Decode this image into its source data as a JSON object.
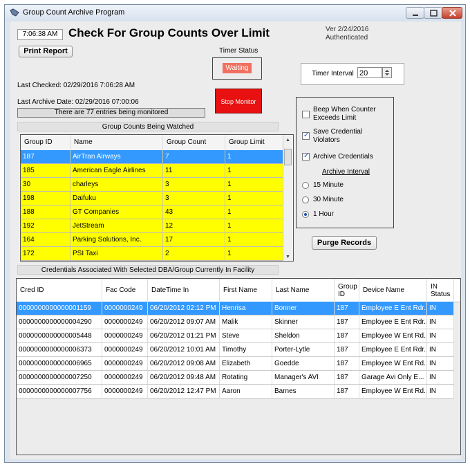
{
  "window": {
    "title": "Group Count Archive Program"
  },
  "header": {
    "time": "7:06:38 AM",
    "title": "Check For Group Counts Over Limit",
    "version": "Ver 2/24/2016",
    "auth": "Authenticated"
  },
  "controls": {
    "print_label": "Print Report",
    "timer_status_label": "Timer Status",
    "timer_status_value": "Waiting",
    "timer_interval_label": "Timer Interval",
    "timer_interval_value": "20",
    "stop_label": "Stop Monitor",
    "purge_label": "Purge Records"
  },
  "status": {
    "last_checked": "Last Checked: 02/29/2016 7:06:28 AM",
    "last_archive": "Last Archive Date: 02/29/2016 07:00:06",
    "entries": "There are 77 entries being monitored"
  },
  "options": {
    "beep": "Beep When Counter Exceeds Limit",
    "save_violators": "Save Credential Violators",
    "archive_credentials": "Archive Credentials",
    "archive_interval_label": "Archive Interval",
    "r15": "15 Minute",
    "r30": "30 Minute",
    "r60": "1 Hour",
    "beep_checked": false,
    "save_checked": true,
    "archive_checked": true,
    "interval_selected": "1 Hour"
  },
  "group_counts": {
    "title": "Group Counts Being Watched",
    "columns": [
      "Group ID",
      "Name",
      "Group Count",
      "Group Limit"
    ],
    "rows": [
      [
        "187",
        "AirTran Airways",
        "7",
        "1"
      ],
      [
        "185",
        "American Eagle Airlines",
        "11",
        "1"
      ],
      [
        "30",
        "charleys",
        "3",
        "1"
      ],
      [
        "198",
        "Daifuku",
        "3",
        "1"
      ],
      [
        "188",
        "GT Companies",
        "43",
        "1"
      ],
      [
        "192",
        "JetStream",
        "12",
        "1"
      ],
      [
        "164",
        "Parking Solutions, Inc.",
        "17",
        "1"
      ],
      [
        "172",
        "PSI Taxi",
        "2",
        "1"
      ]
    ]
  },
  "credentials": {
    "title": "Credentials Associated With Selected DBA/Group Currently In Facility",
    "columns": [
      "Cred ID",
      "Fac Code",
      "DateTime In",
      "First Name",
      "Last Name",
      "Group ID",
      "Device Name",
      "IN Status"
    ],
    "rows": [
      [
        "0000000000000001159",
        "0000000249",
        "06/20/2012 02:12 PM",
        "Henrisa",
        "Bonner",
        "187",
        "Employee E Ent Rdr...",
        "IN"
      ],
      [
        "0000000000000004290",
        "0000000249",
        "06/20/2012 09:07 AM",
        "Malik",
        "Skinner",
        "187",
        "Employee E Ent Rdr...",
        "IN"
      ],
      [
        "0000000000000005448",
        "0000000249",
        "06/20/2012 01:21 PM",
        "Steve",
        "Sheldon",
        "187",
        "Employee W Ent Rd...",
        "IN"
      ],
      [
        "0000000000000006373",
        "0000000249",
        "06/20/2012 10:01 AM",
        "Timothy",
        "Porter-Lytle",
        "187",
        "Employee E Ent Rdr...",
        "IN"
      ],
      [
        "0000000000000006965",
        "0000000249",
        "06/20/2012 09:08 AM",
        "Elizabeth",
        "Goedde",
        "187",
        "Employee W Ent Rd...",
        "IN"
      ],
      [
        "0000000000000007250",
        "0000000249",
        "06/20/2012 09:48 AM",
        "Rotating",
        "Manager's AVI",
        "187",
        "Garage Avi Only E...",
        "IN"
      ],
      [
        "0000000000000007756",
        "0000000249",
        "06/20/2012 12:47 PM",
        "Aaron",
        "Barnes",
        "187",
        "Employee W Ent Rd...",
        "IN"
      ]
    ]
  }
}
